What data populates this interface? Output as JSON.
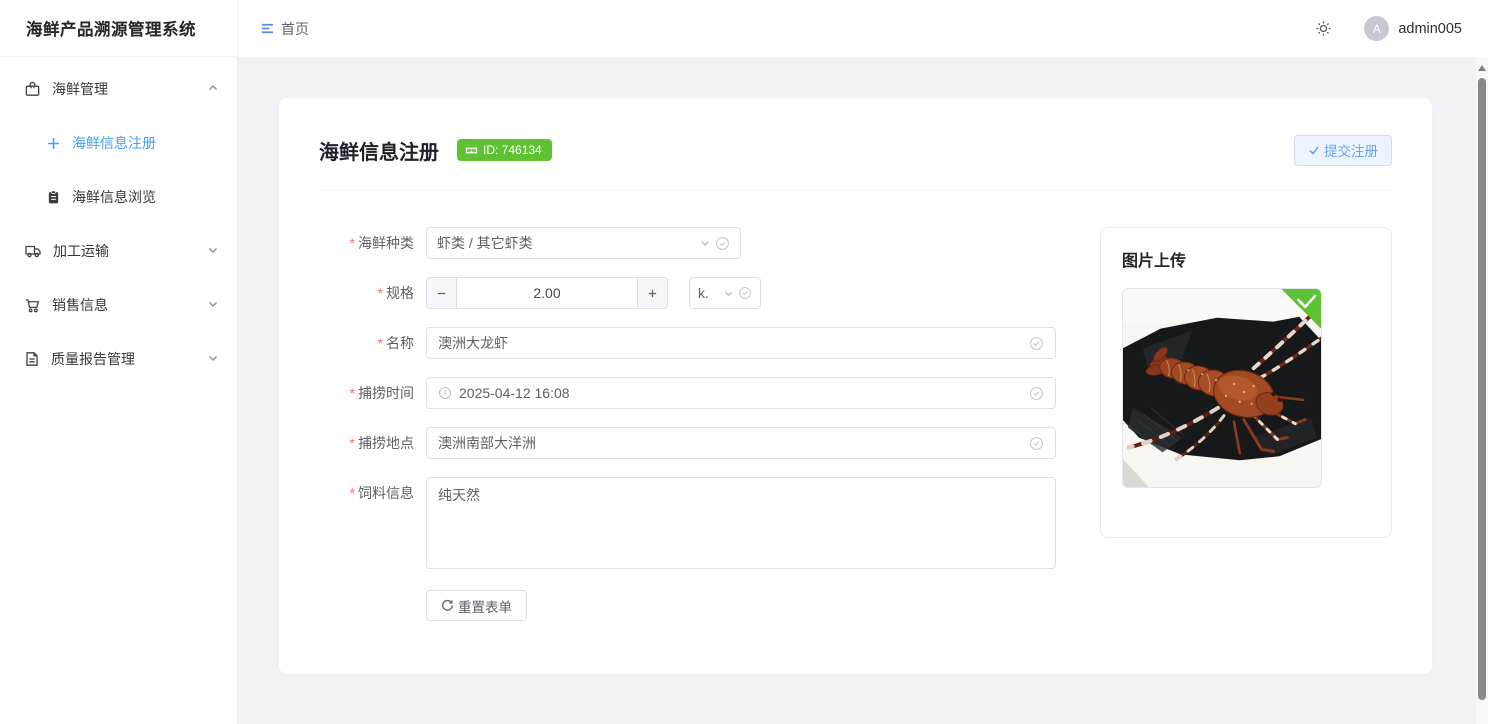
{
  "app": {
    "title": "海鲜产品溯源管理系统"
  },
  "header": {
    "breadcrumb": "首页",
    "username": "admin005",
    "avatar_letter": "A",
    "icons": [
      "collapse-menu-icon",
      "light-theme-icon"
    ]
  },
  "sidebar": {
    "items": [
      {
        "label": "海鲜管理",
        "icon": "package-icon",
        "state": "expanded"
      },
      {
        "label": "海鲜信息注册",
        "icon": "plus-icon",
        "active": true
      },
      {
        "label": "海鲜信息浏览",
        "icon": "clipboard-icon",
        "active": false
      },
      {
        "label": "加工运输",
        "icon": "truck-icon",
        "state": "collapsed"
      },
      {
        "label": "销售信息",
        "icon": "cart-icon",
        "state": "collapsed"
      },
      {
        "label": "质量报告管理",
        "icon": "report-icon",
        "state": "collapsed"
      }
    ]
  },
  "form": {
    "title": "海鲜信息注册",
    "id_badge": "ID: 746134",
    "submit_label": "提交注册",
    "reset_label": "重置表单",
    "fields": {
      "species": {
        "label": "海鲜种类",
        "value": "虾类 / 其它虾类",
        "required": true
      },
      "spec": {
        "label": "规格",
        "value": "2.00",
        "unit": "k.",
        "required": true
      },
      "name": {
        "label": "名称",
        "value": "澳洲大龙虾",
        "required": true
      },
      "catch_time": {
        "label": "捕捞时间",
        "value": "2025-04-12 16:08",
        "required": true
      },
      "catch_place": {
        "label": "捕捞地点",
        "value": "澳洲南部大洋洲",
        "required": true
      },
      "feed": {
        "label": "饲料信息",
        "value": "纯天然",
        "required": true
      }
    }
  },
  "upload": {
    "title": "图片上传",
    "image_status": "uploaded-success"
  },
  "colors": {
    "primary": "#409eff",
    "success": "#5ec233",
    "danger": "#f56c6c",
    "content_bg": "#f0f2f5"
  }
}
